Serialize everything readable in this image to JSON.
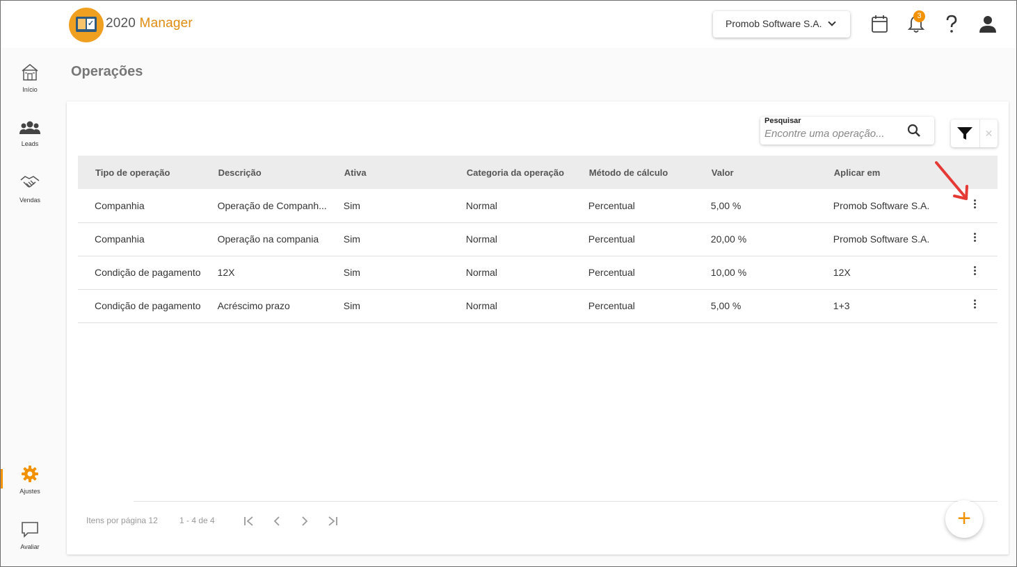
{
  "app": {
    "name_num": "2020",
    "name_word": " Manager"
  },
  "header": {
    "company": "Promob Software S.A.",
    "notifications_count": "3",
    "icons": [
      "calendar-icon",
      "bell-icon",
      "help-icon",
      "user-icon"
    ]
  },
  "sidebar": {
    "items": [
      {
        "label": "Início",
        "icon": "home-icon"
      },
      {
        "label": "Leads",
        "icon": "people-icon"
      },
      {
        "label": "Vendas",
        "icon": "handshake-icon"
      },
      {
        "label": "Ajustes",
        "icon": "gear-icon",
        "active": true
      },
      {
        "label": "Avaliar",
        "icon": "chat-icon"
      }
    ]
  },
  "page": {
    "title": "Operações"
  },
  "search": {
    "label": "Pesquisar",
    "placeholder": "Encontre uma operação..."
  },
  "table": {
    "headers": [
      "Tipo de operação",
      "Descrição",
      "Ativa",
      "Categoria da operação",
      "Método de cálculo",
      "Valor",
      "Aplicar em"
    ],
    "rows": [
      [
        "Companhia",
        "Operação de Companh...",
        "Sim",
        "Normal",
        "Percentual",
        "5,00 %",
        "Promob Software S.A."
      ],
      [
        "Companhia",
        "Operação na compania",
        "Sim",
        "Normal",
        "Percentual",
        "20,00 %",
        "Promob Software S.A."
      ],
      [
        "Condição de pagamento",
        "12X",
        "Sim",
        "Normal",
        "Percentual",
        "10,00 %",
        "12X"
      ],
      [
        "Condição de pagamento",
        "Acréscimo prazo",
        "Sim",
        "Normal",
        "Percentual",
        "5,00 %",
        "1+3"
      ]
    ]
  },
  "pagination": {
    "per_page_label": "Itens por página 12",
    "range": "1 - 4 de 4"
  },
  "colors": {
    "accent": "#f39200",
    "annotation_arrow": "#e53935"
  }
}
